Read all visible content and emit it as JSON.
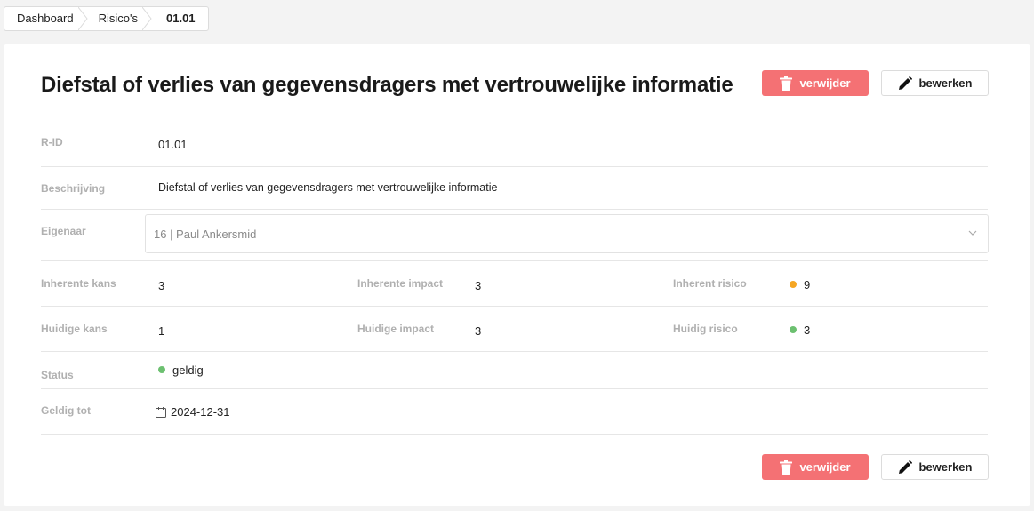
{
  "breadcrumb": {
    "items": [
      "Dashboard",
      "Risico's",
      "01.01"
    ]
  },
  "page": {
    "title": "Diefstal of verlies van gegevensdragers met vertrouwelijke informatie"
  },
  "actions": {
    "delete_label": "verwijder",
    "edit_label": "bewerken"
  },
  "fields": {
    "rid_label": "R-ID",
    "rid_value": "01.01",
    "description_label": "Beschrijving",
    "description_value": "Diefstal of verlies van gegevensdragers met vertrouwelijke informatie",
    "owner_label": "Eigenaar",
    "owner_value": "16 | Paul Ankersmid",
    "inherent_kans_label": "Inherente kans",
    "inherent_kans_value": "3",
    "inherent_impact_label": "Inherente impact",
    "inherent_impact_value": "3",
    "inherent_risico_label": "Inherent risico",
    "inherent_risico_value": "9",
    "huidige_kans_label": "Huidige kans",
    "huidige_kans_value": "1",
    "huidige_impact_label": "Huidige impact",
    "huidige_impact_value": "3",
    "huidig_risico_label": "Huidig risico",
    "huidig_risico_value": "3",
    "status_label": "Status",
    "status_value": "geldig",
    "valid_until_label": "Geldig tot",
    "valid_until_value": "2024-12-31"
  },
  "colors": {
    "danger": "#f47174",
    "status_orange": "#f5a623",
    "status_green": "#6cc070"
  },
  "icons": [
    "trash-icon",
    "pencil-icon",
    "chevron-down-icon",
    "calendar-icon"
  ]
}
